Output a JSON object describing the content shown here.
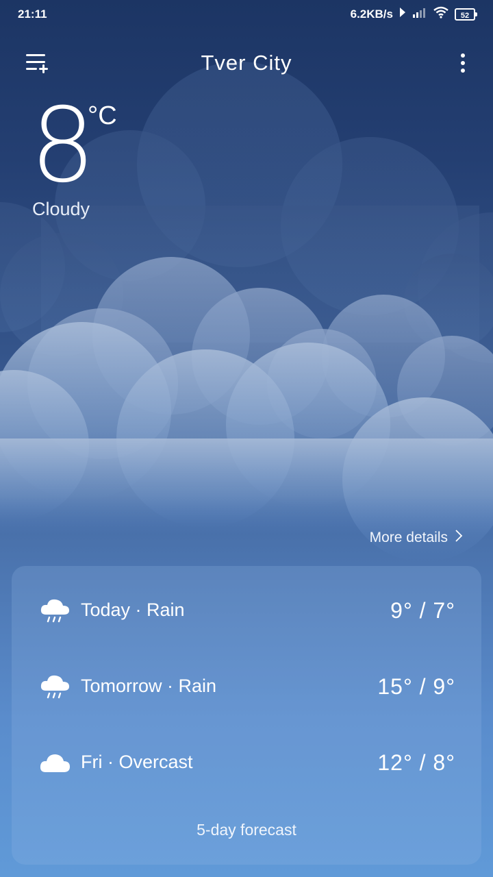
{
  "status_bar": {
    "time": "21:11",
    "net_speed": "6.2KB/s",
    "battery": "52"
  },
  "header": {
    "city": "Tver  City",
    "manage_cities_icon": "list-plus-icon",
    "menu_icon": "more-vert-icon"
  },
  "current": {
    "temperature": "8",
    "unit": "°C",
    "condition": "Cloudy"
  },
  "more_details": {
    "label": "More details",
    "icon": "chevron-right-icon"
  },
  "forecast": {
    "days": [
      {
        "label": "Today · Rain",
        "temps": "9° /  7°",
        "icon": "cloud-rain-icon"
      },
      {
        "label": "Tomorrow · Rain",
        "temps": "15° /  9°",
        "icon": "cloud-rain-icon"
      },
      {
        "label": "Fri · Overcast",
        "temps": "12° /  8°",
        "icon": "cloud-icon"
      }
    ],
    "link_label": "5-day forecast"
  },
  "colors": {
    "sky_top": "#1c3564",
    "sky_bottom": "#609ad8",
    "text": "#ffffff"
  }
}
